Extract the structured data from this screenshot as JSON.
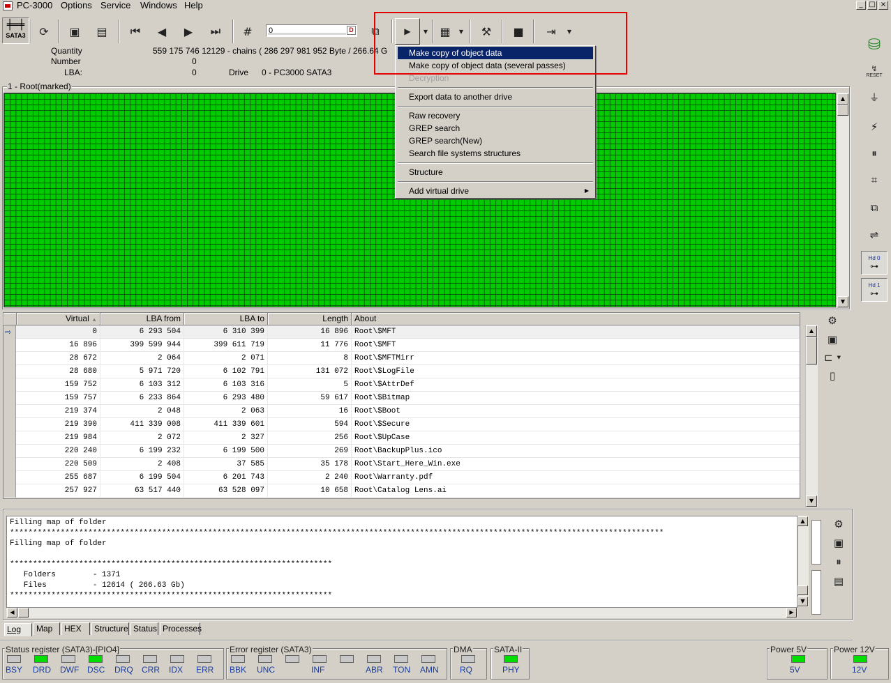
{
  "menubar": {
    "title": "PC-3000",
    "items": [
      "Options",
      "Service",
      "Windows",
      "Help"
    ],
    "window_controls": [
      "_",
      "□",
      "×"
    ]
  },
  "toolbar": {
    "sata_label": "SATA3",
    "lba_input_value": "0",
    "icons": [
      "save-icon",
      "refresh-icon",
      "first-icon",
      "prev-icon",
      "next-icon",
      "last-icon",
      "hash-icon",
      "run-icon",
      "grid-icon",
      "tools-icon",
      "stop-icon",
      "exit-icon"
    ]
  },
  "info": {
    "quantity_label": "Quantity",
    "quantity_value": "559 175 746   12129 - chains  ( 286 297 981 952 Byte /  266.64 G",
    "number_label": "Number",
    "number_value": "0",
    "lba_label": "LBA:",
    "lba_value": "0",
    "drive_label": "Drive",
    "drive_value": "0 - PC3000 SATA3"
  },
  "map": {
    "group_title": "1 - Root(marked)"
  },
  "table": {
    "columns": [
      "Virtual",
      "LBA from",
      "LBA to",
      "Length",
      "About"
    ],
    "sort_arrow": "▲",
    "rows": [
      {
        "virtual": "0",
        "from": "6 293 504",
        "to": "6 310 399",
        "length": "16 896",
        "about": "Root\\$MFT"
      },
      {
        "virtual": "16 896",
        "from": "399 599 944",
        "to": "399 611 719",
        "length": "11 776",
        "about": "Root\\$MFT"
      },
      {
        "virtual": "28 672",
        "from": "2 064",
        "to": "2 071",
        "length": "8",
        "about": "Root\\$MFTMirr"
      },
      {
        "virtual": "28 680",
        "from": "5 971 720",
        "to": "6 102 791",
        "length": "131 072",
        "about": "Root\\$LogFile"
      },
      {
        "virtual": "159 752",
        "from": "6 103 312",
        "to": "6 103 316",
        "length": "5",
        "about": "Root\\$AttrDef"
      },
      {
        "virtual": "159 757",
        "from": "6 233 864",
        "to": "6 293 480",
        "length": "59 617",
        "about": "Root\\$Bitmap"
      },
      {
        "virtual": "219 374",
        "from": "2 048",
        "to": "2 063",
        "length": "16",
        "about": "Root\\$Boot"
      },
      {
        "virtual": "219 390",
        "from": "411 339 008",
        "to": "411 339 601",
        "length": "594",
        "about": "Root\\$Secure"
      },
      {
        "virtual": "219 984",
        "from": "2 072",
        "to": "2 327",
        "length": "256",
        "about": "Root\\$UpCase"
      },
      {
        "virtual": "220 240",
        "from": "6 199 232",
        "to": "6 199 500",
        "length": "269",
        "about": "Root\\BackupPlus.ico"
      },
      {
        "virtual": "220 509",
        "from": "2 408",
        "to": "37 585",
        "length": "35 178",
        "about": "Root\\Start_Here_Win.exe"
      },
      {
        "virtual": "255 687",
        "from": "6 199 504",
        "to": "6 201 743",
        "length": "2 240",
        "about": "Root\\Warranty.pdf"
      },
      {
        "virtual": "257 927",
        "from": "63 517 440",
        "to": "63 528 097",
        "length": "10 658",
        "about": "Root\\Catalog Lens.ai"
      }
    ]
  },
  "log": {
    "lines": [
      "Filling map of folder",
      "**********************************************************************************************************************************************",
      "Filling map of folder",
      "",
      "**********************************************************************",
      "   Folders        - 1371",
      "   Files          - 12614 ( 266.63 Gb)",
      "**********************************************************************"
    ]
  },
  "tabs": [
    "Log",
    "Map",
    "HEX",
    "Structure",
    "Status",
    "Processes"
  ],
  "status": {
    "status_register_title": "Status register (SATA3)-[PIO4]",
    "status_leds": [
      {
        "label": "BSY",
        "on": false
      },
      {
        "label": "DRD",
        "on": true
      },
      {
        "label": "DWF",
        "on": false
      },
      {
        "label": "DSC",
        "on": true
      },
      {
        "label": "DRQ",
        "on": false
      },
      {
        "label": "CRR",
        "on": false
      },
      {
        "label": "IDX",
        "on": false
      },
      {
        "label": "ERR",
        "on": false
      }
    ],
    "error_register_title": "Error register (SATA3)",
    "error_leds": [
      {
        "label": "BBK",
        "on": false
      },
      {
        "label": "UNC",
        "on": false
      },
      {
        "label": "",
        "on": false
      },
      {
        "label": "INF",
        "on": false
      },
      {
        "label": "",
        "on": false
      },
      {
        "label": "ABR",
        "on": false
      },
      {
        "label": "TON",
        "on": false
      },
      {
        "label": "AMN",
        "on": false
      }
    ],
    "dma_title": "DMA",
    "dma_led": {
      "label": "RQ",
      "on": false
    },
    "sata_title": "SATA-II",
    "sata_led": {
      "label": "PHY",
      "on": true
    },
    "power5_title": "Power 5V",
    "power5_led": {
      "label": "5V",
      "on": true
    },
    "power12_title": "Power 12V",
    "power12_led": {
      "label": "12V",
      "on": true
    }
  },
  "right_panel": {
    "reset_label": "RESET",
    "hd0_label": "Hd 0",
    "hd1_label": "Hd 1"
  },
  "dropdown": {
    "items": [
      {
        "label": "Make copy of object data",
        "highlighted": true
      },
      {
        "label": "Make copy of object data (several passes)"
      },
      {
        "label": "Decryption",
        "disabled": true
      },
      {
        "label": "Export data to another drive"
      },
      {
        "label": "Raw recovery"
      },
      {
        "label": "GREP search"
      },
      {
        "label": "GREP search(New)"
      },
      {
        "label": "Search file systems structures"
      },
      {
        "label": "Structure"
      },
      {
        "label": "Add virtual drive",
        "submenu": true
      }
    ]
  },
  "colors": {
    "map_block": "#00cc00",
    "highlight": "#0a246a",
    "annotation": "#e00000",
    "led_on": "#00dd00"
  }
}
